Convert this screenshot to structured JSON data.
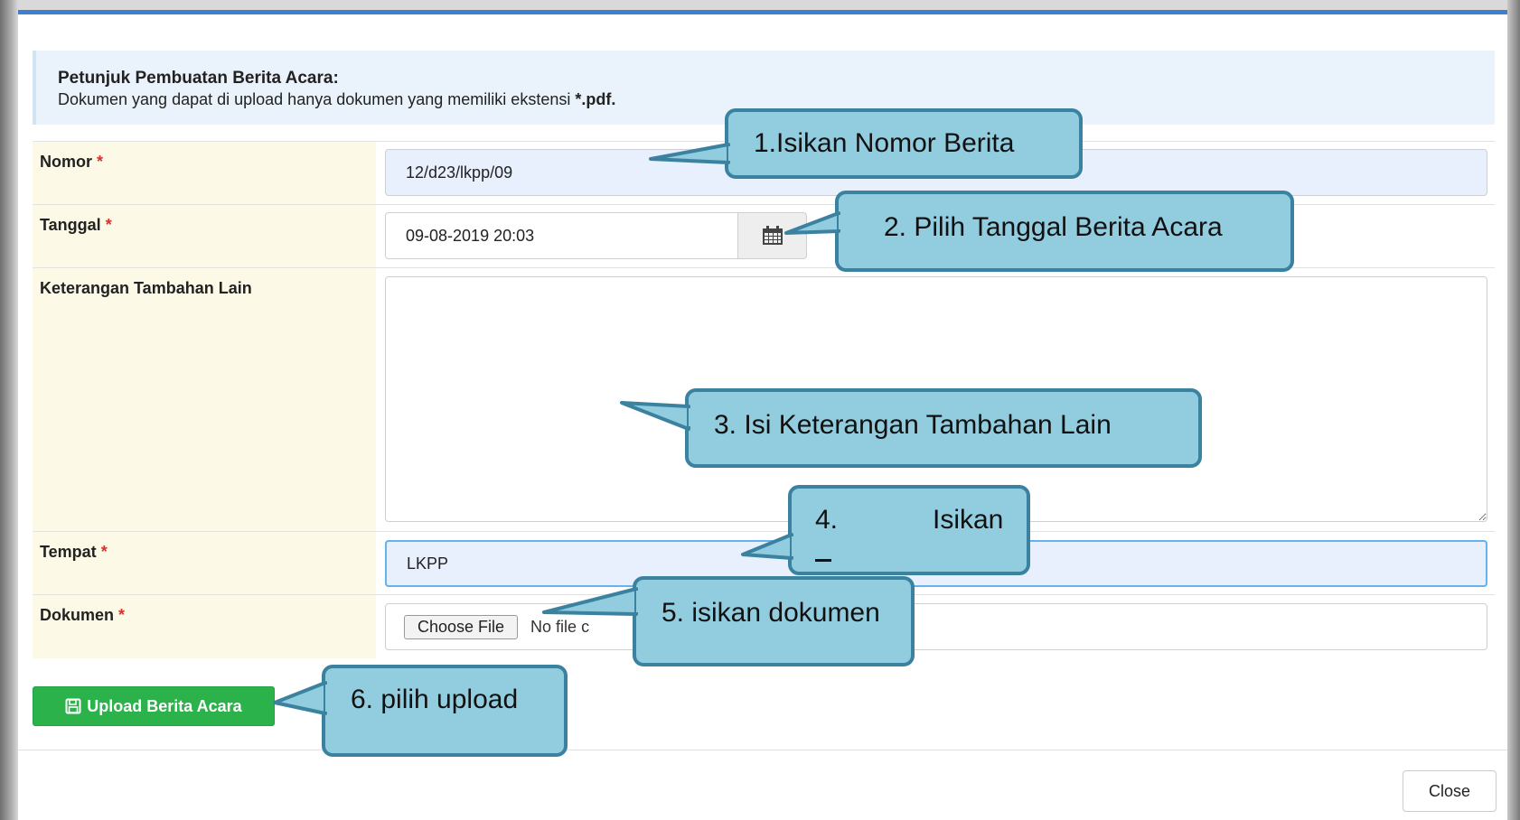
{
  "info": {
    "title": "Petunjuk Pembuatan Berita Acara:",
    "text_prefix": "Dokumen yang dapat di upload hanya dokumen yang memiliki ekstensi",
    "text_ext": "*.pdf."
  },
  "form": {
    "nomor": {
      "label": "Nomor",
      "value": "12/d23/lkpp/09"
    },
    "tanggal": {
      "label": "Tanggal",
      "value": "09-08-2019 20:03"
    },
    "keterangan": {
      "label": "Keterangan Tambahan Lain",
      "value": ""
    },
    "tempat": {
      "label": "Tempat",
      "value": "LKPP"
    },
    "dokumen": {
      "label": "Dokumen",
      "choose_label": "Choose File",
      "no_file_text": "No file c"
    },
    "required_mark": "*"
  },
  "buttons": {
    "upload_label": "Upload Berita Acara",
    "close_label": "Close"
  },
  "callouts": {
    "c1": "1.Isikan Nomor Berita",
    "c2": "2. Pilih Tanggal Berita Acara",
    "c3": "3. Isi Keterangan Tambahan Lain",
    "c4_num": "4.",
    "c4_text": "Isikan",
    "c5": "5. isikan dokumen",
    "c6": "6. pilih upload"
  },
  "colors": {
    "upload_button": "#2bb24a",
    "callout_fill": "#92cddf",
    "callout_border": "#3b82a0",
    "label_bg": "#fcfae6",
    "required": "#d9312b",
    "accent": "#3f7fd0"
  },
  "icons": {
    "calendar": "calendar-icon",
    "upload": "save-icon"
  }
}
